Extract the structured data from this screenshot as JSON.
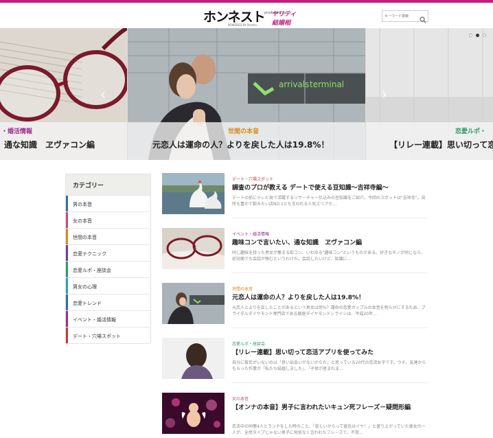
{
  "header": {
    "logo_main": "ホンネスト",
    "logo_sub": "produced by",
    "logo_brand": "ヤリティ結婚相",
    "logo_powered": "POWERED BY Pandra",
    "search_placeholder": "キーワード検索"
  },
  "slider": {
    "slides": [
      {
        "category": "・婚活情報",
        "title": "通な知識　ヱヴァコン編"
      },
      {
        "category": "世間の本音",
        "title": "元恋人は運命の人？よりを戻した人は19.8%！"
      },
      {
        "category": "恋愛ルポ・",
        "title": "【リレー連載】思い切って恋"
      }
    ],
    "prev_arrow": "‹",
    "next_arrow": "›"
  },
  "sidebar": {
    "title": "カテゴリー",
    "items": [
      {
        "label": "男の本音",
        "color": "#2f6fb3"
      },
      {
        "label": "女の本音",
        "color": "#c24c7e"
      },
      {
        "label": "世間の本音",
        "color": "#d98a1a"
      },
      {
        "label": "恋愛テクニック",
        "color": "#6a3ea1"
      },
      {
        "label": "恋愛ルポ・座談会",
        "color": "#2f9a6b"
      },
      {
        "label": "男女の心理",
        "color": "#2aa3b8"
      },
      {
        "label": "恋愛トレンド",
        "color": "#3c63b8"
      },
      {
        "label": "イベント・婚活情報",
        "color": "#9b2a8c"
      },
      {
        "label": "デート・穴場スポット",
        "color": "#c23a3a"
      }
    ]
  },
  "articles": [
    {
      "category": "デート・穴場スポット",
      "category_color": "#c23a3a",
      "title": "調査のプロが教える デートで使える豆知識〜吉祥寺編〜",
      "desc": "デートの前にテレビ局で活躍するリサーチャー仕込みの豆知識をご紹介。今回のスポットは\"吉祥寺\"。見所も豊かで飲みたい店NO.1とも言われる人気エリアだ…"
    },
    {
      "category": "イベント・婚活情報",
      "category_color": "#9b2a8c",
      "title": "趣味コンで言いたい、通な知識　ヱヴァコン編",
      "desc": "同じ趣味を持った男女が集まる街コン、いわゆる\"趣味コン\"というものがある。好きなモノが同じなら、初対面でも会話が弾むというわけだ。会話したいけど、知識に…"
    },
    {
      "category": "世間の本音",
      "category_color": "#d98a1a",
      "title": "元恋人は運命の人？よりを戻した人は19.8%！",
      "desc": "元恋人とよりを戻したことがあるという男女は何%？運命の恋愛カップルの本音を明らかにするため、ブライダルダイヤモンド専門店である銀座ダイヤモンドシライシは、平成20年…"
    },
    {
      "category": "恋愛ルポ・座談会",
      "category_color": "#2f9a6b",
      "title": "【リレー連載】思い切って恋活アプリを使ってみた",
      "desc": "自分に彼氏がいないのは「良い出会いがないからだ」と思っている20代の恋活女子です。ウチ、友達からもらった作業が「私たち結婚しました」、「子供が産まれま…"
    },
    {
      "category": "女の本音",
      "category_color": "#c24c7e",
      "title": "【オンナの本音】男子に言われたいキュン死フレーズ－疑問形編",
      "desc": "恋活中の同僚4人とランチをした時のこと、「寂しいからって彼氏はイヤ！」と盛り上がっていた彼女の一人が、全然タイプじゃない男子に何気なく言われたフレーズで、不覚…"
    }
  ]
}
